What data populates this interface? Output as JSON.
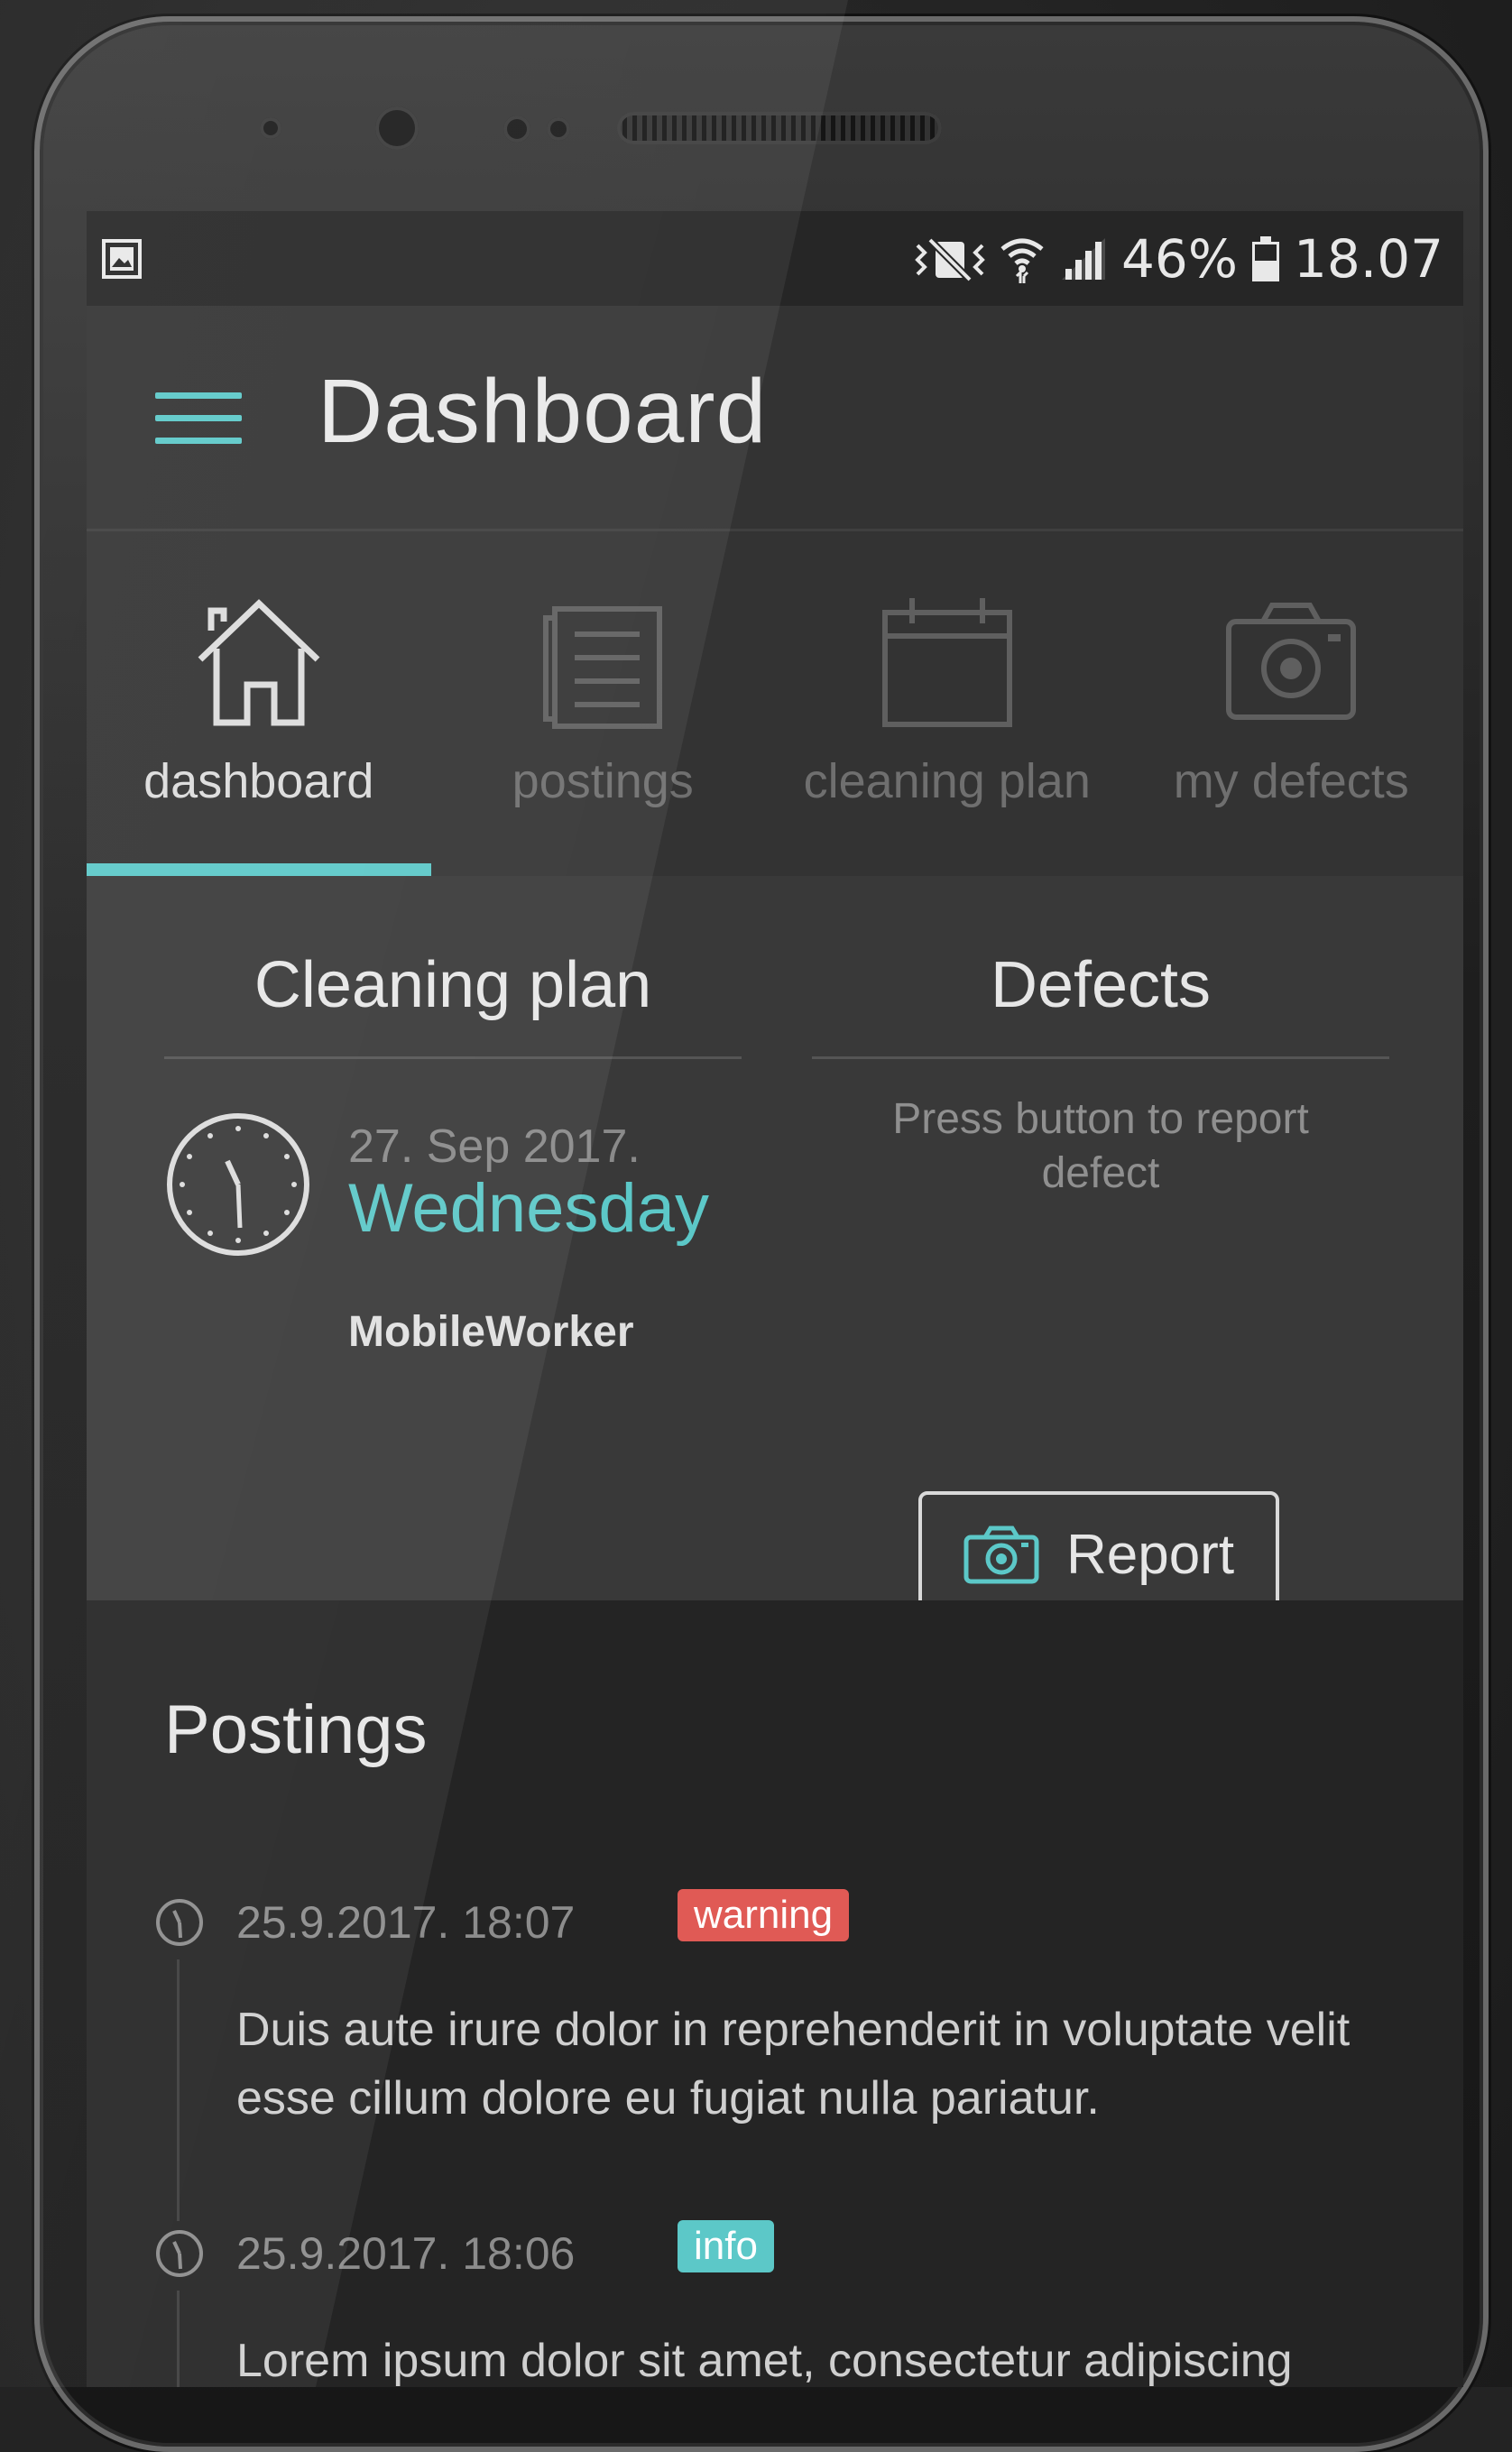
{
  "status_bar": {
    "battery": "46%",
    "time": "18.07"
  },
  "app_bar": {
    "title": "Dashboard"
  },
  "tabs": [
    {
      "label": "dashboard",
      "icon": "home-icon",
      "active": true
    },
    {
      "label": "postings",
      "icon": "document-icon",
      "active": false
    },
    {
      "label": "cleaning plan",
      "icon": "calendar-icon",
      "active": false
    },
    {
      "label": "my defects",
      "icon": "camera-icon",
      "active": false
    }
  ],
  "cleaning_plan": {
    "title": "Cleaning plan",
    "date": "27. Sep 2017.",
    "weekday": "Wednesday",
    "worker": "MobileWorker"
  },
  "defects": {
    "title": "Defects",
    "hint": "Press button to report defect",
    "button_label": "Report"
  },
  "postings": {
    "title": "Postings",
    "items": [
      {
        "time": "25.9.2017. 18:07",
        "badge": "warning",
        "text": "Duis aute irure dolor in reprehenderit in voluptate velit esse cillum dolore eu fugiat nulla pariatur."
      },
      {
        "time": "25.9.2017. 18:06",
        "badge": "info",
        "text": "Lorem ipsum dolor sit amet, consectetur adipiscing"
      }
    ]
  },
  "colors": {
    "accent": "#5cc8c8",
    "warning": "#e05a55",
    "info": "#5cc8c8"
  }
}
